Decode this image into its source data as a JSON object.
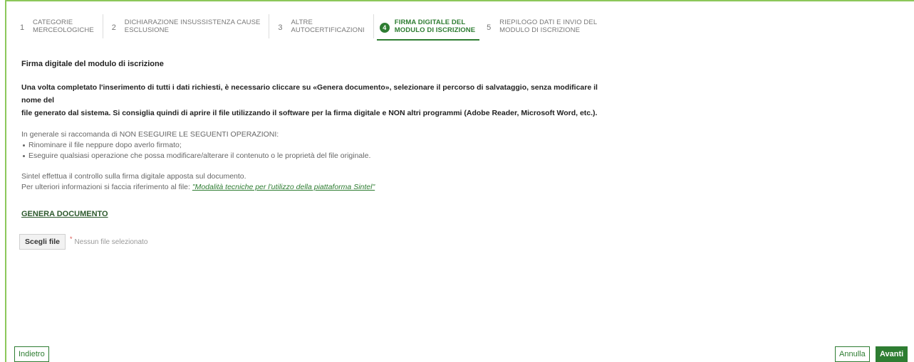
{
  "stepper": {
    "steps": [
      {
        "number": "1",
        "label": "CATEGORIE\nMERCEOLOGICHE"
      },
      {
        "number": "2",
        "label": "DICHIARAZIONE INSUSSISTENZA CAUSE\nESCLUSIONE"
      },
      {
        "number": "3",
        "label": "ALTRE\nAUTOCERTIFICAZIONI"
      },
      {
        "number": "4",
        "label": "FIRMA DIGITALE DEL\nMODULO DI ISCRIZIONE"
      },
      {
        "number": "5",
        "label": "RIEPILOGO DATI E INVIO DEL\nMODULO DI ISCRIZIONE"
      }
    ],
    "active_step": 4
  },
  "content": {
    "title": "Firma digitale del modulo di iscrizione",
    "intro_line1": "Una volta completato l'inserimento di tutti i dati richiesti, è necessario cliccare su «Genera documento», selezionare il percorso di salvataggio, senza modificare il nome del",
    "intro_line2": "file generato dal sistema. Si consiglia quindi di aprire il file utilizzando il software per la firma digitale e NON altri programmi (Adobe Reader, Microsoft Word, etc.).",
    "warning_heading": "In generale si raccomanda di NON ESEGUIRE LE SEGUENTI OPERAZIONI:",
    "warnings": [
      "Rinominare il file neppure dopo averlo firmato;",
      "Eseguire qualsiasi operazione che possa modificare/alterare il contenuto o le proprietà del file originale."
    ],
    "check_note": "Sintel effettua il controllo sulla firma digitale apposta sul documento.",
    "reference_prefix": "Per ulteriori informazioni si faccia riferimento al file: ",
    "reference_link": "\"Modalità tecniche per l'utilizzo della piattaforma Sintel\"",
    "generate_label": "GENERA DOCUMENTO",
    "file_button": "Scegli file",
    "required_mark": "*",
    "file_status": "Nessun file selezionato"
  },
  "footer": {
    "back_label": "Indietro",
    "cancel_label": "Annulla",
    "next_label": "Avanti"
  },
  "colors": {
    "accent": "#2e7d32",
    "frame_border": "#8cc75a"
  }
}
